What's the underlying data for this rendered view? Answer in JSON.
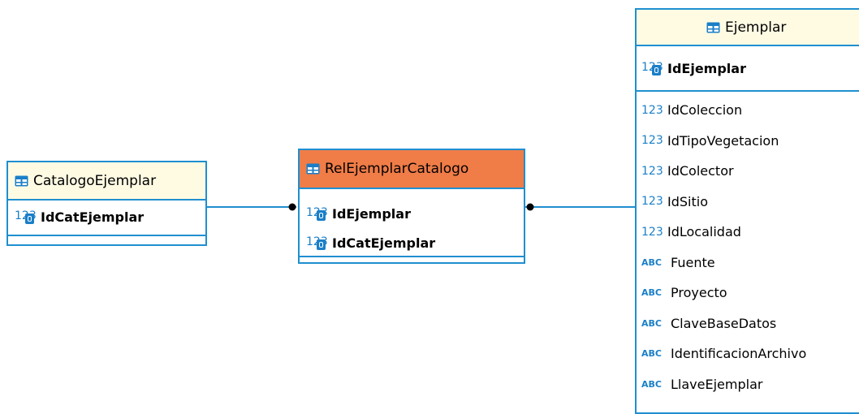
{
  "colors": {
    "border": "#1f8fd0",
    "header_default": "#fffbe3",
    "header_selected": "#f07c47",
    "type_icon": "#1a7fc8"
  },
  "entities": {
    "catalogo": {
      "title": "CatalogoEjemplar",
      "icon": "table-icon",
      "pk": [
        {
          "type": "123",
          "name": "IdCatEjemplar"
        }
      ],
      "columns": []
    },
    "rel": {
      "title": "RelEjemplarCatalogo",
      "icon": "table-icon",
      "selected": true,
      "pk": [
        {
          "type": "123",
          "name": "IdEjemplar"
        },
        {
          "type": "123",
          "name": "IdCatEjemplar"
        }
      ],
      "columns": []
    },
    "ejemplar": {
      "title": "Ejemplar",
      "icon": "table-icon",
      "pk": [
        {
          "type": "123",
          "name": "IdEjemplar"
        }
      ],
      "columns": [
        {
          "type": "123",
          "name": "IdColeccion"
        },
        {
          "type": "123",
          "name": "IdTipoVegetacion"
        },
        {
          "type": "123",
          "name": "IdColector"
        },
        {
          "type": "123",
          "name": "IdSitio"
        },
        {
          "type": "123",
          "name": "IdLocalidad"
        },
        {
          "type": "ABC",
          "name": "Fuente"
        },
        {
          "type": "ABC",
          "name": "Proyecto"
        },
        {
          "type": "ABC",
          "name": "ClaveBaseDatos"
        },
        {
          "type": "ABC",
          "name": "IdentificacionArchivo"
        },
        {
          "type": "ABC",
          "name": "LlaveEjemplar"
        }
      ]
    }
  }
}
